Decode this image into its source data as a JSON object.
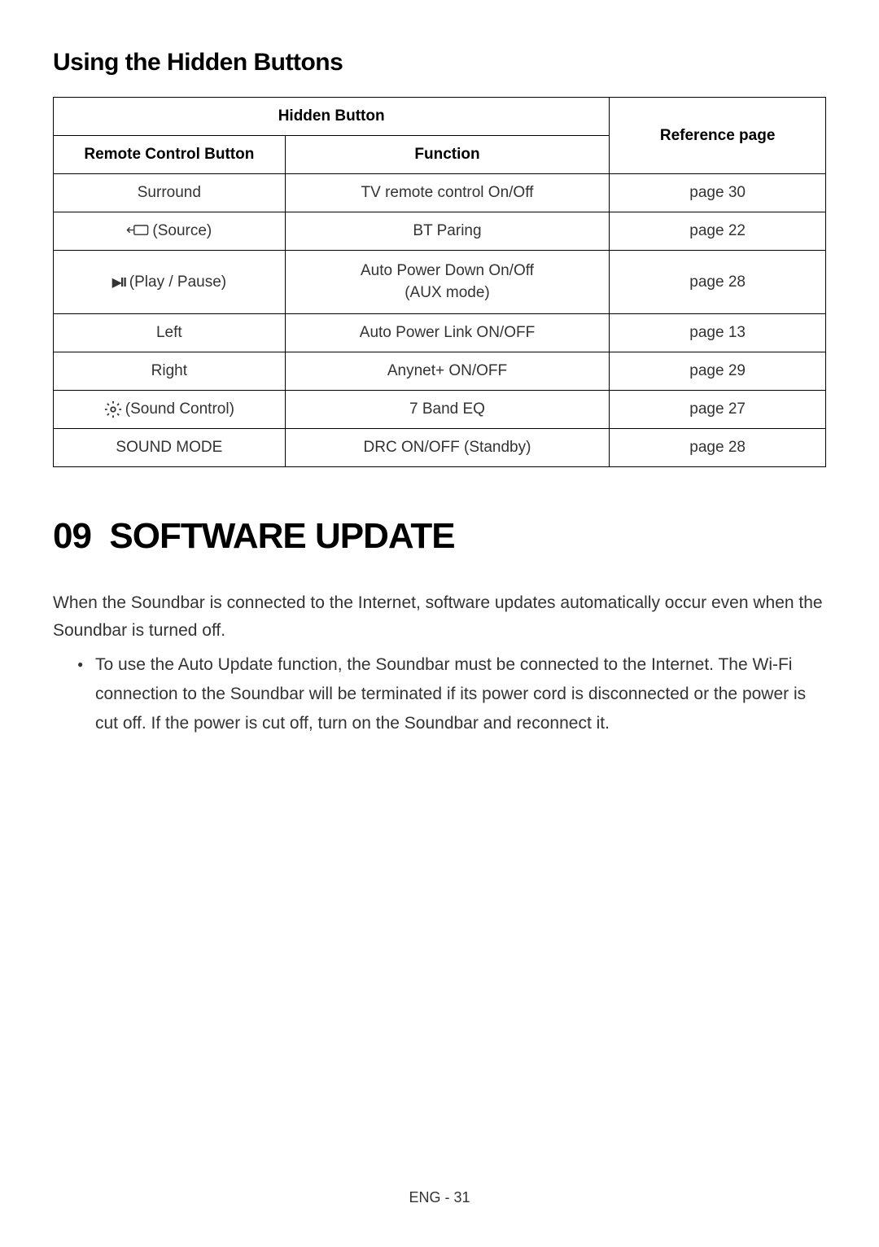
{
  "heading1": "Using the Hidden Buttons",
  "table": {
    "header": {
      "hidden_button": "Hidden Button",
      "reference_page": "Reference page",
      "remote_control_button": "Remote Control Button",
      "function": "Function"
    },
    "rows": [
      {
        "button": "Surround",
        "function": "TV remote control On/Off",
        "reference": "page 30"
      },
      {
        "button_label": "(Source)",
        "function": "BT Paring",
        "reference": "page 22"
      },
      {
        "button_label": " (Play / Pause)",
        "function_line1": "Auto Power Down On/Off",
        "function_line2": "(AUX mode)",
        "reference": "page 28"
      },
      {
        "button": "Left",
        "function": "Auto Power Link ON/OFF",
        "reference": "page 13"
      },
      {
        "button": "Right",
        "function": "Anynet+ ON/OFF",
        "reference": "page 29"
      },
      {
        "button_label": "(Sound Control)",
        "function": "7 Band EQ",
        "reference": "page 27"
      },
      {
        "button": "SOUND MODE",
        "function": "DRC ON/OFF (Standby)",
        "reference": "page 28"
      }
    ]
  },
  "chapter": {
    "number": "09",
    "title": "SOFTWARE UPDATE"
  },
  "body_paragraph": "When the Soundbar is connected to the Internet, software updates automatically occur even when the Soundbar is turned off.",
  "bullet_text": "To use the Auto Update function, the Soundbar must be connected to the Internet. The Wi-Fi connection to the Soundbar will be terminated if its power cord is disconnected or the power is cut off. If the power is cut off, turn on the Soundbar and reconnect it.",
  "footer": "ENG - 31"
}
